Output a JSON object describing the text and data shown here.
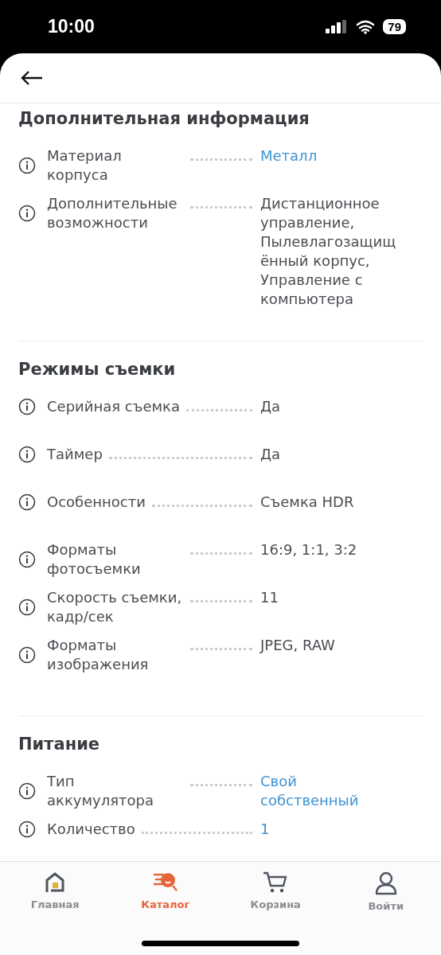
{
  "status_bar": {
    "time": "10:00",
    "battery": "79"
  },
  "sections": [
    {
      "title": "Дополнительная информация",
      "rows": [
        {
          "label": "Материал корпуса",
          "value": "Металл",
          "link": true
        },
        {
          "label": "Дополнительные возможности",
          "value": "Дистанционное управление, Пылевлагозащищённый корпус, Управление с компьютера",
          "link": false
        }
      ]
    },
    {
      "title": "Режимы съемки",
      "rows": [
        {
          "label": "Серийная съемка",
          "value": "Да",
          "link": false
        },
        {
          "label": "Таймер",
          "value": "Да",
          "link": false
        },
        {
          "label": "Особенности",
          "value": "Съемка HDR",
          "link": false
        },
        {
          "label": "Форматы фотосъемки",
          "value": "16:9, 1:1, 3:2",
          "link": false
        },
        {
          "label": "Скорость съемки, кадр/сек",
          "value": "11",
          "link": false
        },
        {
          "label": "Форматы изображения",
          "value": "JPEG, RAW",
          "link": false
        }
      ]
    },
    {
      "title": "Питание",
      "rows": [
        {
          "label": "Тип аккумулятора",
          "value": "Свой собственный",
          "link": true
        },
        {
          "label": "Количество",
          "value": "1",
          "link": true
        }
      ]
    }
  ],
  "nav": [
    {
      "label": "Главная",
      "kind": "home",
      "selected": false
    },
    {
      "label": "Каталог",
      "kind": "catalog",
      "selected": true
    },
    {
      "label": "Корзина",
      "kind": "cart",
      "selected": false
    },
    {
      "label": "Войти",
      "kind": "user",
      "selected": false
    }
  ]
}
